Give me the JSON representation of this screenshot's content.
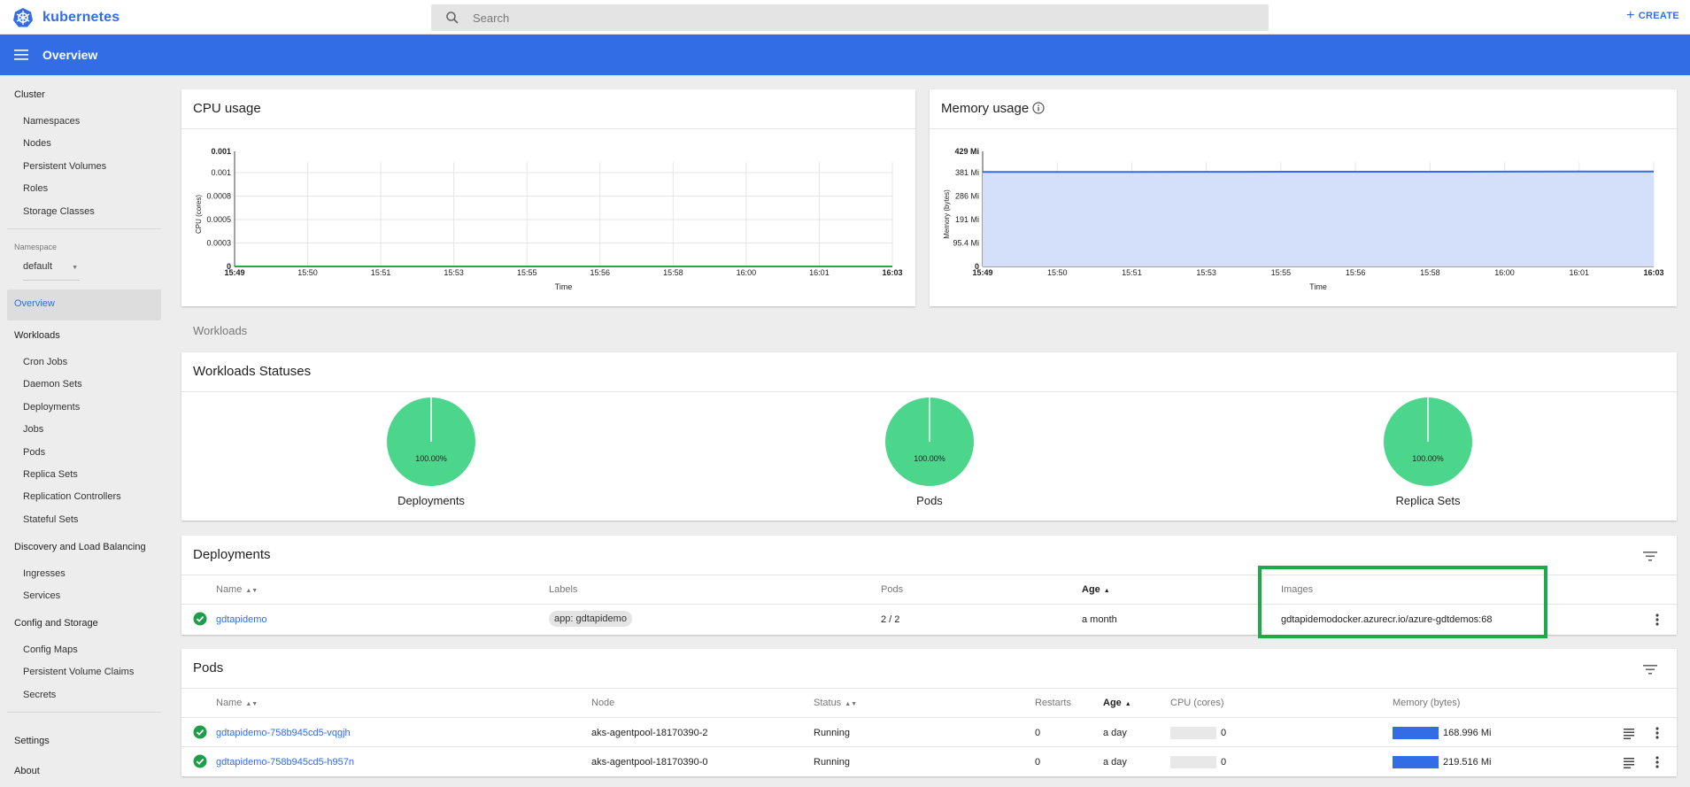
{
  "app": {
    "brand": "kubernetes",
    "create_label": "CREATE",
    "page_title": "Overview"
  },
  "search": {
    "placeholder": "Search"
  },
  "colors": {
    "accent": "#326de6",
    "ok": "#1faa4a",
    "pie": "#4cd68c"
  },
  "sidebar": {
    "cluster_head": "Cluster",
    "cluster_items": [
      "Namespaces",
      "Nodes",
      "Persistent Volumes",
      "Roles",
      "Storage Classes"
    ],
    "namespace_label": "Namespace",
    "namespace_value": "default",
    "overview": "Overview",
    "workloads_head": "Workloads",
    "workloads_items": [
      "Cron Jobs",
      "Daemon Sets",
      "Deployments",
      "Jobs",
      "Pods",
      "Replica Sets",
      "Replication Controllers",
      "Stateful Sets"
    ],
    "discovery_head": "Discovery and Load Balancing",
    "discovery_items": [
      "Ingresses",
      "Services"
    ],
    "config_head": "Config and Storage",
    "config_items": [
      "Config Maps",
      "Persistent Volume Claims",
      "Secrets"
    ],
    "settings": "Settings",
    "about": "About"
  },
  "cpu_card": {
    "title": "CPU usage"
  },
  "memory_card": {
    "title": "Memory usage"
  },
  "chart_data": [
    {
      "type": "line",
      "title": "CPU usage",
      "xlabel": "Time",
      "ylabel": "CPU (cores)",
      "x_ticks": [
        "15:49",
        "15:50",
        "15:51",
        "15:53",
        "15:55",
        "15:56",
        "15:58",
        "16:00",
        "16:01",
        "16:03"
      ],
      "y_ticks": [
        "0",
        "0.0003",
        "0.0005",
        "0.0008",
        "0.001",
        "0.001"
      ],
      "ylim": [
        0,
        0.001
      ],
      "series": [
        {
          "values": [
            0,
            0,
            0,
            0,
            0,
            0,
            0,
            0,
            0,
            0
          ]
        }
      ],
      "grid": true
    },
    {
      "type": "area",
      "title": "Memory usage",
      "xlabel": "Time",
      "ylabel": "Memory (bytes)",
      "x_ticks": [
        "15:49",
        "15:50",
        "15:51",
        "15:53",
        "15:55",
        "15:56",
        "15:58",
        "16:00",
        "16:01",
        "16:03"
      ],
      "y_ticks": [
        "0",
        "95.4 Mi",
        "191 Mi",
        "286 Mi",
        "381 Mi",
        "429 Mi"
      ],
      "ylim": [
        0,
        429
      ],
      "series": [
        {
          "values": [
            388,
            388,
            388,
            388.5,
            389,
            389,
            389,
            389.5,
            390,
            390
          ]
        }
      ],
      "grid": true
    },
    {
      "type": "pie",
      "charts": [
        {
          "label": "Deployments",
          "value_label": "100.00%",
          "value": 100
        },
        {
          "label": "Pods",
          "value_label": "100.00%",
          "value": 100
        },
        {
          "label": "Replica Sets",
          "value_label": "100.00%",
          "value": 100
        }
      ]
    }
  ],
  "workloads": {
    "section_label": "Workloads",
    "statuses_title": "Workloads Statuses"
  },
  "deployments": {
    "title": "Deployments",
    "headers": {
      "name": "Name",
      "labels": "Labels",
      "pods": "Pods",
      "age": "Age",
      "images": "Images"
    },
    "rows": [
      {
        "name": "gdtapidemo",
        "label": "app: gdtapidemo",
        "pods": "2 / 2",
        "age": "a month",
        "image": "gdtapidemodocker.azurecr.io/azure-gdtdemos:68"
      }
    ]
  },
  "pods": {
    "title": "Pods",
    "headers": {
      "name": "Name",
      "node": "Node",
      "status": "Status",
      "restarts": "Restarts",
      "age": "Age",
      "cpu": "CPU (cores)",
      "memory": "Memory (bytes)"
    },
    "rows": [
      {
        "name": "gdtapidemo-758b945cd5-vqgjh",
        "node": "aks-agentpool-18170390-2",
        "status": "Running",
        "restarts": "0",
        "age": "a day",
        "cpu": "0",
        "memory": "168.996 Mi"
      },
      {
        "name": "gdtapidemo-758b945cd5-h957n",
        "node": "aks-agentpool-18170390-0",
        "status": "Running",
        "restarts": "0",
        "age": "a day",
        "cpu": "0",
        "memory": "219.516 Mi"
      }
    ]
  }
}
